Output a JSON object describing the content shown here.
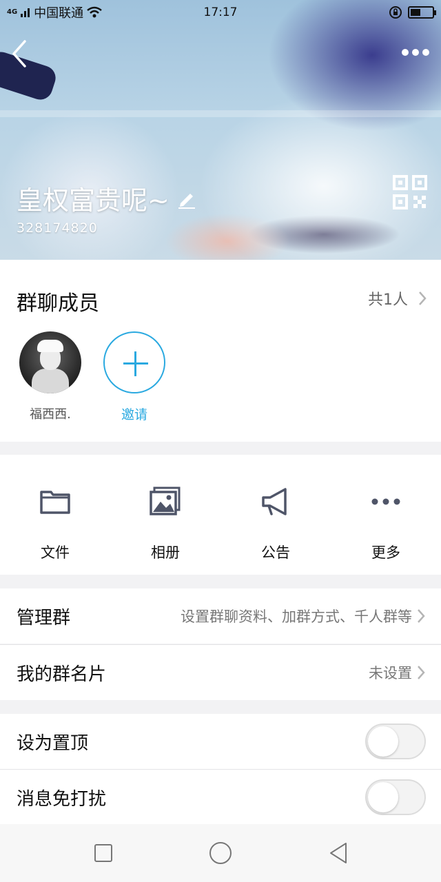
{
  "status_bar": {
    "network": "4G",
    "carrier": "中国联通",
    "time": "17:17",
    "battery_level": 0.45
  },
  "header": {
    "group_name": "皇权富贵呢~",
    "group_id": "328174820",
    "icons": {
      "back": "back-chevron-icon",
      "more": "more-dots-icon",
      "edit": "pencil-icon",
      "qr": "qr-code-icon"
    }
  },
  "members": {
    "title": "群聊成员",
    "count_label": "共1人",
    "list": [
      {
        "name": "福西西."
      }
    ],
    "invite_label": "邀请"
  },
  "toolbar": {
    "items": [
      {
        "label": "文件",
        "icon": "folder-icon"
      },
      {
        "label": "相册",
        "icon": "photo-album-icon"
      },
      {
        "label": "公告",
        "icon": "megaphone-icon"
      },
      {
        "label": "更多",
        "icon": "more-dots-icon"
      }
    ]
  },
  "settings": {
    "manage": {
      "label": "管理群",
      "value": "设置群聊资料、加群方式、千人群等"
    },
    "card": {
      "label": "我的群名片",
      "value": "未设置"
    },
    "pin": {
      "label": "设为置顶",
      "on": false
    },
    "mute": {
      "label": "消息免打扰",
      "on": false
    }
  },
  "colors": {
    "accent": "#2aa9e0",
    "icon_gray": "#4f5568"
  }
}
